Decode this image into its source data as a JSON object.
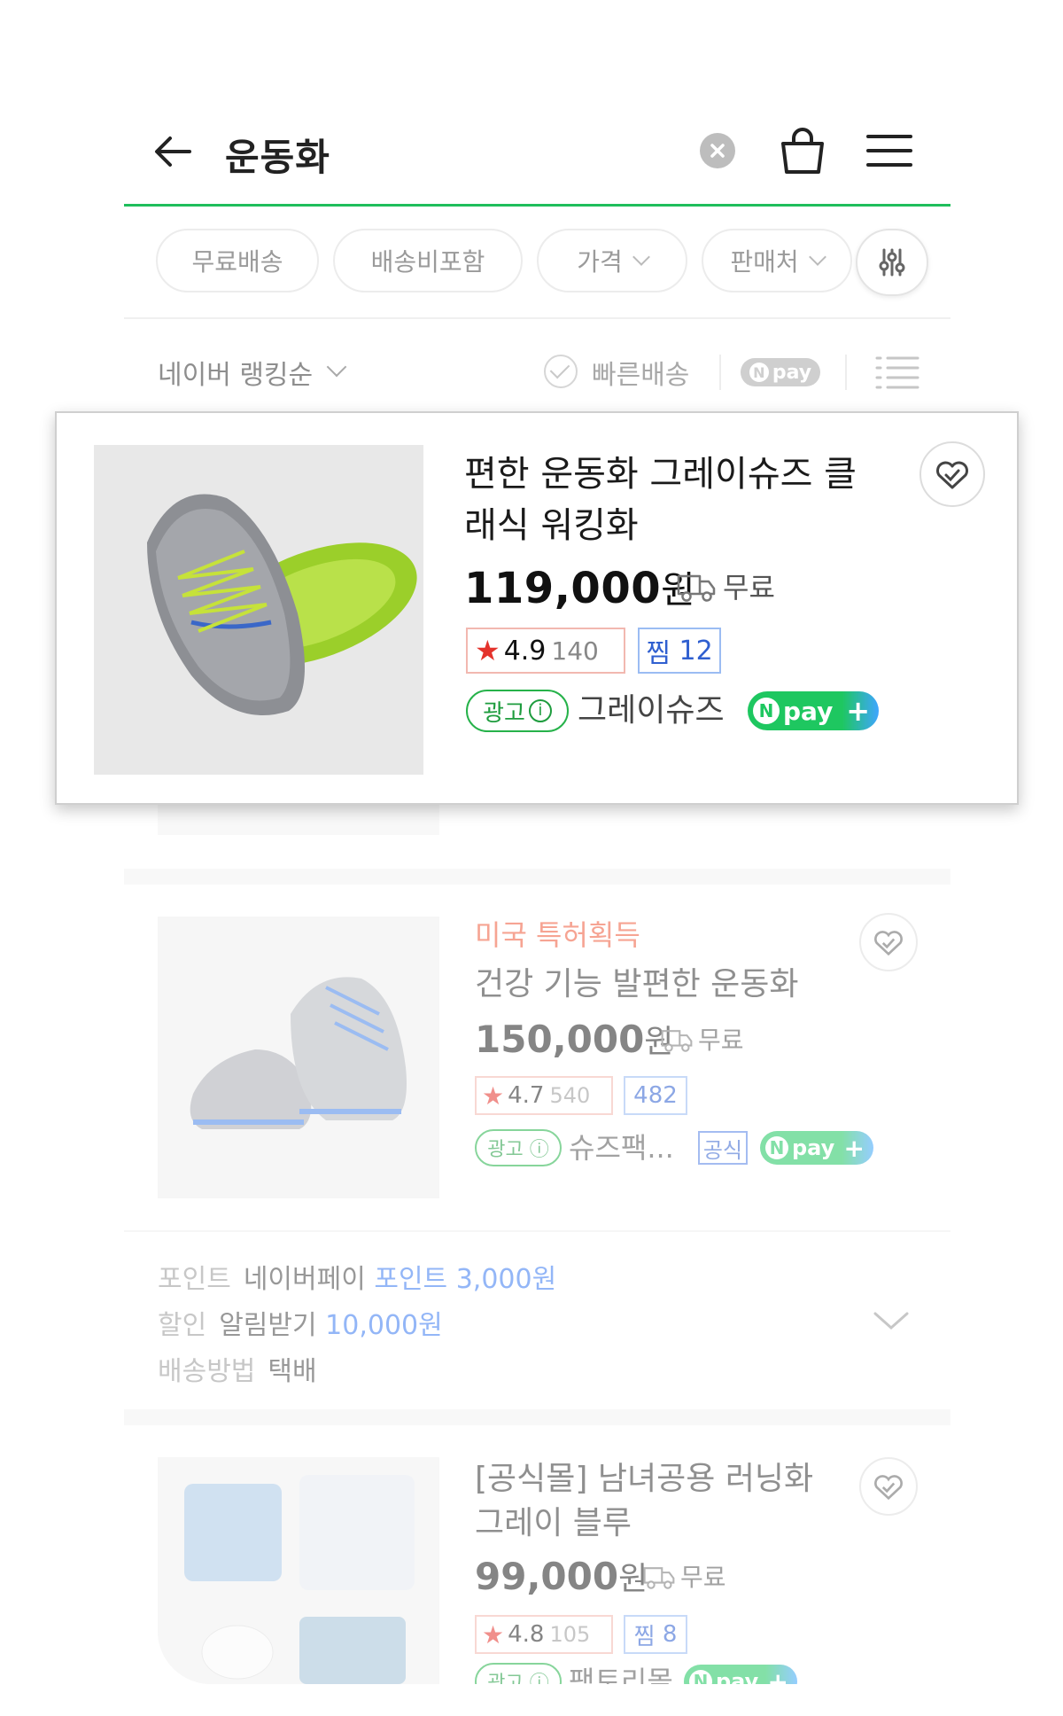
{
  "header": {
    "search_query": "운동화"
  },
  "filters": {
    "chips": [
      {
        "label": "무료배송",
        "has_dropdown": false
      },
      {
        "label": "배송비포함",
        "has_dropdown": false
      },
      {
        "label": "가격",
        "has_dropdown": true
      },
      {
        "label": "판매처",
        "has_dropdown": true
      }
    ]
  },
  "sort": {
    "selected": "네이버 랭킹순",
    "fast_delivery_label": "빠른배송",
    "npay_label": "pay"
  },
  "featured": {
    "title": "편한 운동화 그레이슈즈 클래식 워킹화",
    "price": "119,000",
    "currency": "원",
    "shipping": "무료",
    "rating": "4.9",
    "review_count": "140",
    "jjim_label": "찜",
    "jjim_count": "12",
    "ad_label": "광고",
    "seller": "그레이슈즈",
    "npay_label": "pay"
  },
  "items": [
    {
      "promo": "미국 특허획득",
      "title": "건강 기능 발편한 운동화",
      "price": "150,000",
      "currency": "원",
      "shipping": "무료",
      "rating": "4.7",
      "review_count": "540",
      "jjim_count": "482",
      "ad_label": "광고",
      "seller": "슈즈팩...",
      "official_label": "공식",
      "npay_label": "pay"
    },
    {
      "title": "[공식몰] 남녀공용 러닝화 그레이 블루",
      "price": "99,000",
      "currency": "원",
      "shipping": "무료",
      "rating": "4.8",
      "review_count": "105",
      "jjim_label": "찜",
      "jjim_count": "8",
      "ad_label": "광고",
      "seller": "팩토리몰",
      "npay_label": "pay"
    }
  ],
  "benefits": {
    "point_key": "포인트",
    "point_source": "네이버페이",
    "point_value": "포인트 3,000원",
    "discount_key": "할인",
    "discount_source": "알림받기",
    "discount_value": "10,000원",
    "delivery_key": "배송방법",
    "delivery_value": "택배"
  },
  "colors": {
    "accent_green": "#1fbe5c",
    "price_red_star": "#e4332c",
    "jjim_blue": "#2f5fd0"
  }
}
